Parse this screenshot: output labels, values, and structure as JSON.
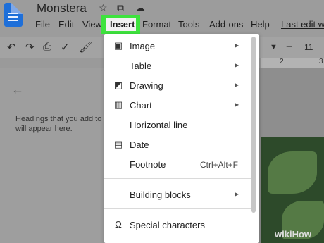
{
  "app": {
    "title": "Monstera",
    "last_edit": "Last edit wa"
  },
  "menu": [
    "File",
    "Edit",
    "View",
    "Insert",
    "Format",
    "Tools",
    "Add-ons",
    "Help"
  ],
  "toolbar": {
    "font_size": "11"
  },
  "ruler": {
    "mark1": "2",
    "mark2": "3"
  },
  "outline": {
    "text": "Headings that you add to\nwill appear here."
  },
  "dropdown": {
    "items": [
      {
        "label": "Image",
        "icon": "image-icon",
        "submenu": true
      },
      {
        "label": "Table",
        "icon": "",
        "submenu": true
      },
      {
        "label": "Drawing",
        "icon": "drawing-icon",
        "submenu": true
      },
      {
        "label": "Chart",
        "icon": "chart-icon",
        "submenu": true
      },
      {
        "label": "Horizontal line",
        "icon": "horizontal-line-icon",
        "submenu": false
      },
      {
        "label": "Date",
        "icon": "calendar-icon",
        "submenu": false
      },
      {
        "label": "Footnote",
        "icon": "",
        "shortcut": "Ctrl+Alt+F",
        "submenu": false
      },
      {
        "label": "Building blocks",
        "icon": "",
        "submenu": true
      },
      {
        "label": "Special characters",
        "icon": "omega-icon",
        "submenu": false
      }
    ]
  },
  "watermark": "wikiHow",
  "colors": {
    "highlight": "#3ee33e",
    "doc_blue": "#1e6fd9"
  }
}
